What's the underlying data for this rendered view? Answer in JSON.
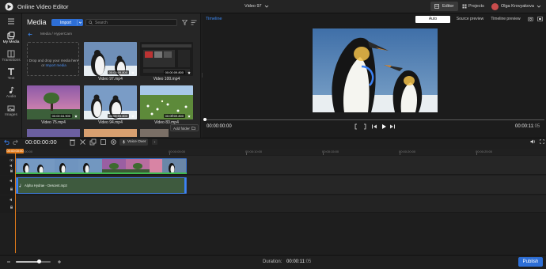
{
  "app": {
    "title": "Online Video Editor",
    "project_name": "Video 97"
  },
  "top_nav": {
    "editor_label": "Editor",
    "projects_label": "Projects",
    "user_name": "Olga Krovyakova"
  },
  "left_nav": {
    "items": [
      {
        "label": "My Media",
        "icon": "media-icon"
      },
      {
        "label": "Transitions",
        "icon": "transitions-icon"
      },
      {
        "label": "Text",
        "icon": "text-icon"
      },
      {
        "label": "Audio",
        "icon": "audio-icon"
      },
      {
        "label": "Images",
        "icon": "images-icon"
      }
    ]
  },
  "media": {
    "title": "Media",
    "import_label": "Import",
    "search_placeholder": "Search",
    "breadcrumb": "Media / HyperCam",
    "dropzone_line1": "Drop and drop your media here",
    "dropzone_line2_prefix": "or ",
    "dropzone_link": "Import media",
    "items": [
      {
        "name": "Video 97.mp4",
        "duration": "00:00:09.800"
      },
      {
        "name": "Video 100.mp4",
        "duration": "00:00:09.800"
      },
      {
        "name": "Video 75.mp4",
        "duration": "00:00:04.900"
      },
      {
        "name": "Video 94.mp4",
        "duration": "00:00:09.800"
      },
      {
        "name": "Video 83.mp4",
        "duration": "00:00:09.800"
      }
    ],
    "add_folder_tooltip": "Add folder"
  },
  "preview": {
    "tab_label": "Timeline",
    "modes": {
      "auto": "Auto",
      "source": "Source preview",
      "timeline": "Timeline preview"
    },
    "current_time": "00:00:00:00",
    "total_time_main": "00:00:11",
    "total_time_frames": ":05"
  },
  "timeline": {
    "time": "00:00:00:00",
    "voice_over_label": "Voice Over",
    "playhead_tag": "00:00:00:00",
    "ruler_labels": [
      "00:00:00:00",
      "00:00:05:00",
      "00:00:10:00",
      "00:00:15:00",
      "00:00:20:00",
      "00:00:25:00"
    ],
    "audio_clip_label": "Alpha Hydrae - Descent.mp3"
  },
  "bottom": {
    "zoom_level": 0.68,
    "duration_label": "Duration:",
    "duration_value": "00:00:11",
    "duration_frames": ":05",
    "publish_label": "Publish"
  },
  "colors": {
    "accent": "#2e6fd6",
    "playhead": "#e07a1a",
    "link": "#3d8af5"
  }
}
